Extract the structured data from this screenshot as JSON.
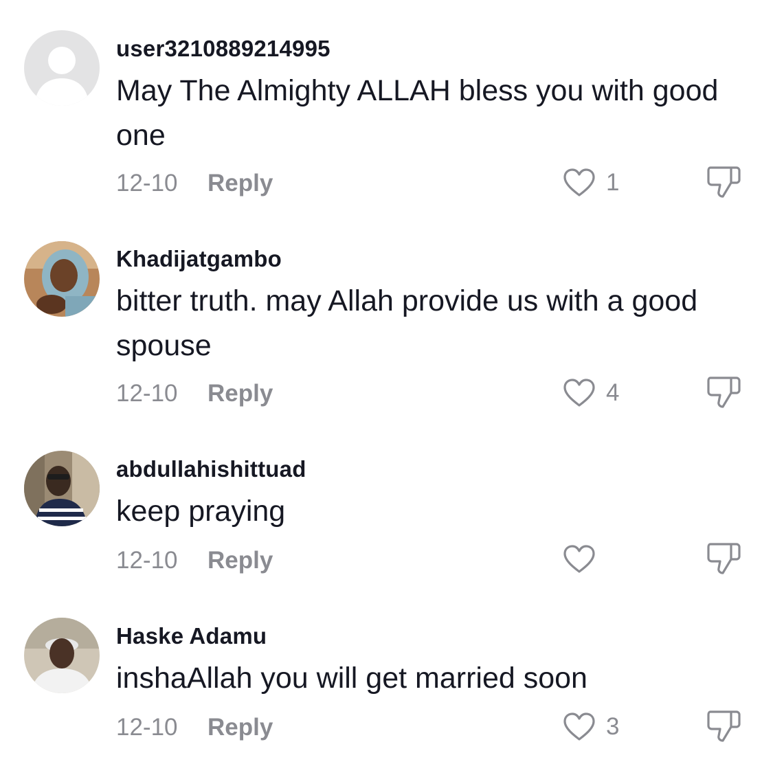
{
  "comments": [
    {
      "username": "user3210889214995",
      "text": "May The Almighty ALLAH bless you with good one",
      "date": "12-10",
      "reply_label": "Reply",
      "likes": "1"
    },
    {
      "username": "Khadijatgambo",
      "text": "bitter truth. may Allah provide us with a good spouse",
      "date": "12-10",
      "reply_label": "Reply",
      "likes": "4"
    },
    {
      "username": "abdullahishittuad",
      "text": "keep praying",
      "date": "12-10",
      "reply_label": "Reply",
      "likes": ""
    },
    {
      "username": "Haske Adamu",
      "text": "inshaAllah you will get married soon",
      "date": "12-10",
      "reply_label": "Reply",
      "likes": "3"
    }
  ],
  "icons": {
    "like": "heart-outline-icon",
    "dislike": "thumbs-down-icon"
  },
  "colors": {
    "text_primary": "#161823",
    "text_secondary": "#8a8b91"
  }
}
